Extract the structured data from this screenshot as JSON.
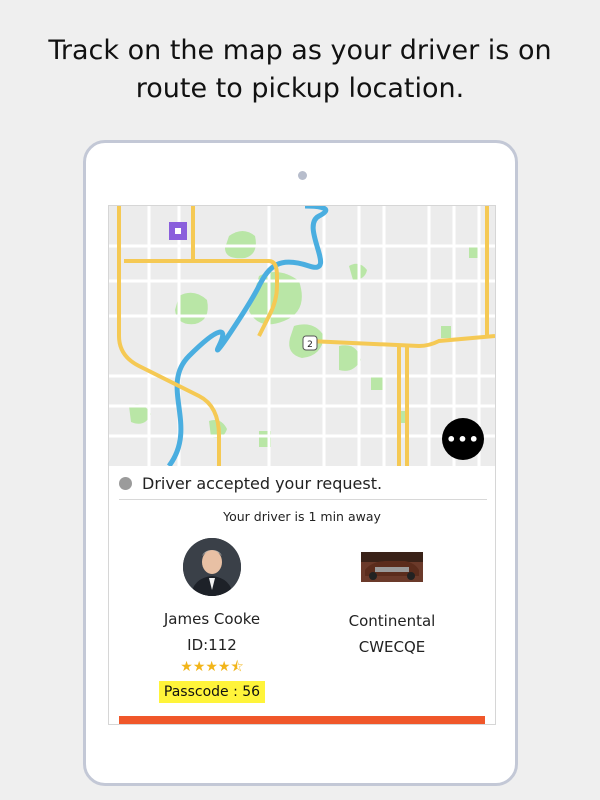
{
  "headline": {
    "line1": "Track on the map as your driver is on",
    "line2": "route to pickup location."
  },
  "map": {
    "route_shield": "2",
    "more_button_label": "•••",
    "colors": {
      "background": "#ececec",
      "major_road": "#f5c954",
      "river": "#4aaee0",
      "park": "#b9e6a6",
      "minor_road": "#ffffff",
      "pickup_marker": "#8a5fdc"
    }
  },
  "status": {
    "text": "Driver accepted your request."
  },
  "eta_text": "Your driver is 1 min away",
  "driver": {
    "name": "James Cooke",
    "id": "ID:112",
    "rating_stars": "★★★★⯪",
    "rating": 4.5,
    "passcode": "Passcode : 56"
  },
  "vehicle": {
    "model": "Continental",
    "plate": "CWECQE"
  },
  "colors": {
    "accent_bar": "#f0572a",
    "passcode_highlight": "#fff43a",
    "star": "#f2b51a"
  }
}
